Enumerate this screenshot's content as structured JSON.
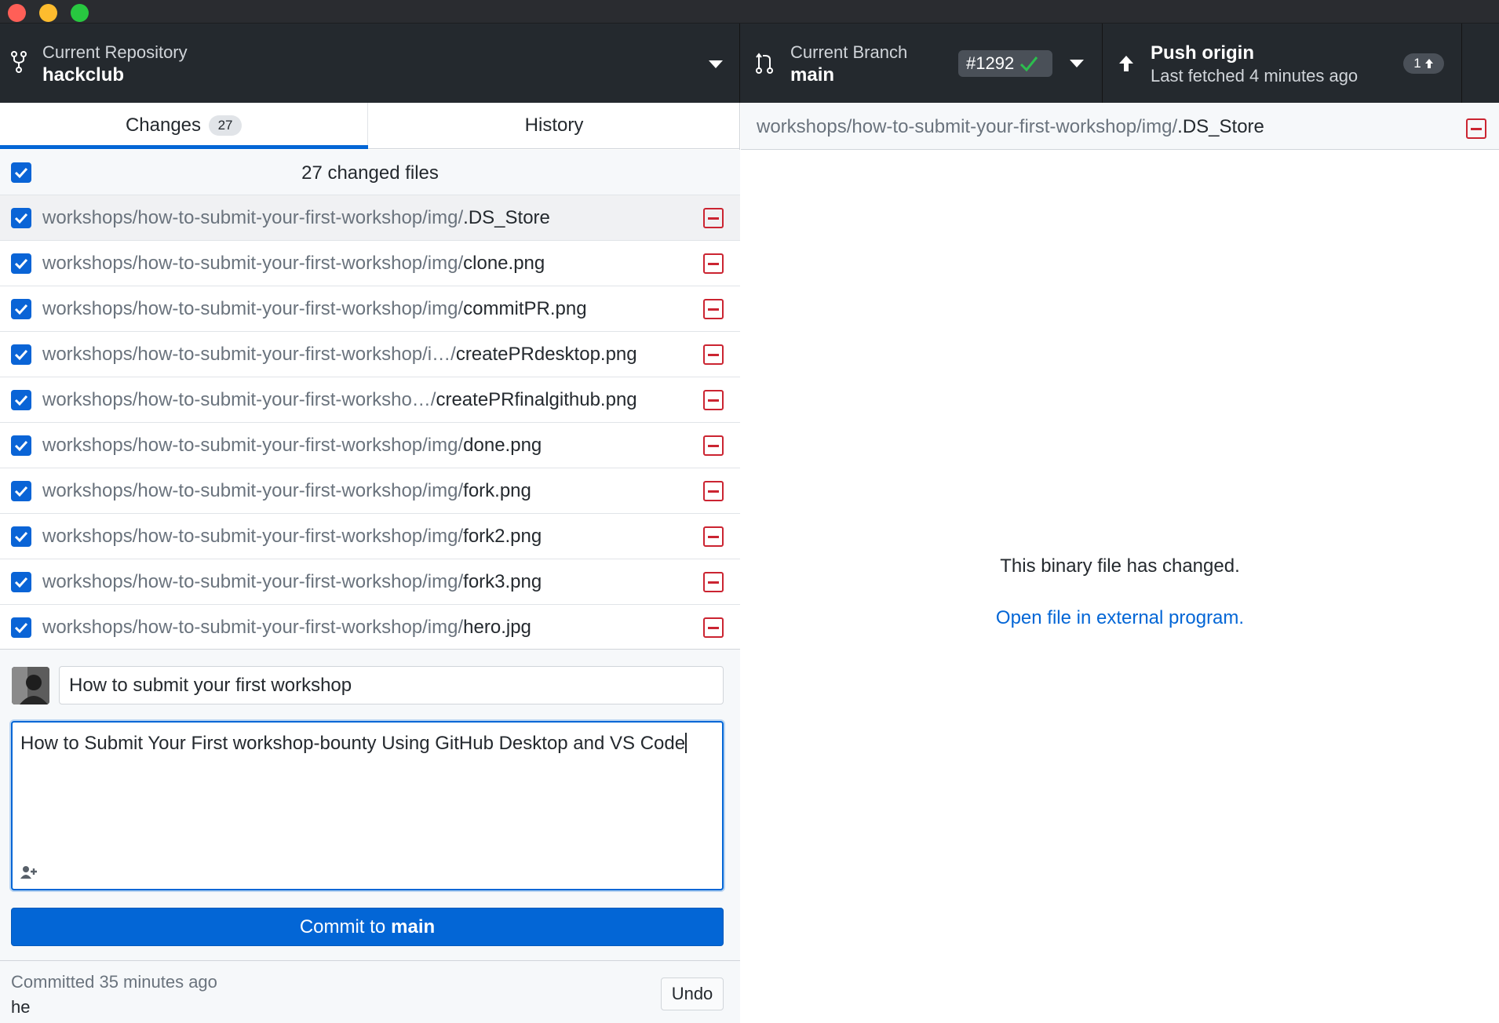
{
  "toolbar": {
    "repository": {
      "label": "Current Repository",
      "value": "hackclub"
    },
    "branch": {
      "label": "Current Branch",
      "value": "main",
      "pr_number": "#1292"
    },
    "push": {
      "label": "Push origin",
      "subtitle": "Last fetched 4 minutes ago",
      "ahead_count": "1"
    }
  },
  "tabs": {
    "changes": {
      "label": "Changes",
      "count": "27"
    },
    "history": {
      "label": "History"
    }
  },
  "changes": {
    "select_all_label": "27 changed files",
    "files": [
      {
        "dir": "workshops/how-to-submit-your-first-workshop/img/",
        "name": ".DS_Store"
      },
      {
        "dir": "workshops/how-to-submit-your-first-workshop/img/",
        "name": "clone.png"
      },
      {
        "dir": "workshops/how-to-submit-your-first-workshop/img/",
        "name": "commitPR.png"
      },
      {
        "dir": "workshops/how-to-submit-your-first-workshop/i…/",
        "name": "createPRdesktop.png"
      },
      {
        "dir": "workshops/how-to-submit-your-first-worksho…/",
        "name": "createPRfinalgithub.png"
      },
      {
        "dir": "workshops/how-to-submit-your-first-workshop/img/",
        "name": "done.png"
      },
      {
        "dir": "workshops/how-to-submit-your-first-workshop/img/",
        "name": "fork.png"
      },
      {
        "dir": "workshops/how-to-submit-your-first-workshop/img/",
        "name": "fork2.png"
      },
      {
        "dir": "workshops/how-to-submit-your-first-workshop/img/",
        "name": "fork3.png"
      },
      {
        "dir": "workshops/how-to-submit-your-first-workshop/img/",
        "name": "hero.jpg"
      }
    ]
  },
  "commit": {
    "summary_value": "How to submit your first workshop",
    "description_value": "How to Submit Your First workshop-bounty Using GitHub Desktop and VS Code",
    "button_prefix": "Commit to",
    "button_branch": "main"
  },
  "last_commit": {
    "time": "Committed 35 minutes ago",
    "message": "he",
    "undo_label": "Undo"
  },
  "diff": {
    "dir": "workshops/how-to-submit-your-first-workshop/img/",
    "name": ".DS_Store",
    "binary_message": "This binary file has changed.",
    "open_link": "Open file in external program."
  },
  "colors": {
    "accent": "#0366d6",
    "toolbar_bg": "#24292e",
    "deleted": "#cb2431",
    "check_green": "#2cbe4e"
  }
}
